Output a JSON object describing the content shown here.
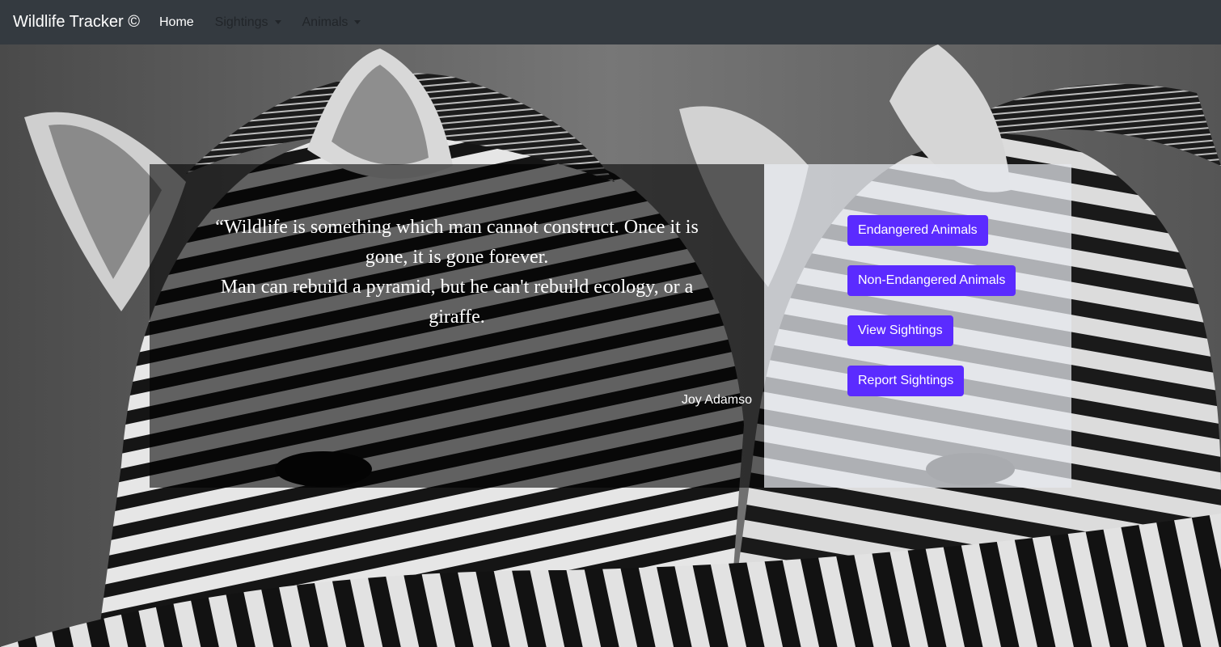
{
  "navbar": {
    "brand": "Wildlife Tracker ©",
    "home": "Home",
    "sightings": "Sightings",
    "animals": "Animals"
  },
  "hero": {
    "image": "zebras-background",
    "quote_line1": "“Wildlife is something which man cannot construct. Once it is gone, it is gone forever.",
    "quote_line2": "Man can rebuild a pyramid, but he can't rebuild ecology, or a giraffe.",
    "author": "Joy Adamso"
  },
  "actions": {
    "endangered": "Endangered Animals",
    "non_endangered": "Non-Endangered Animals",
    "view_sightings": "View Sightings",
    "report_sightings": "Report Sightings"
  },
  "colors": {
    "navbar_bg": "#343a40",
    "button_bg": "#5b2bff"
  }
}
